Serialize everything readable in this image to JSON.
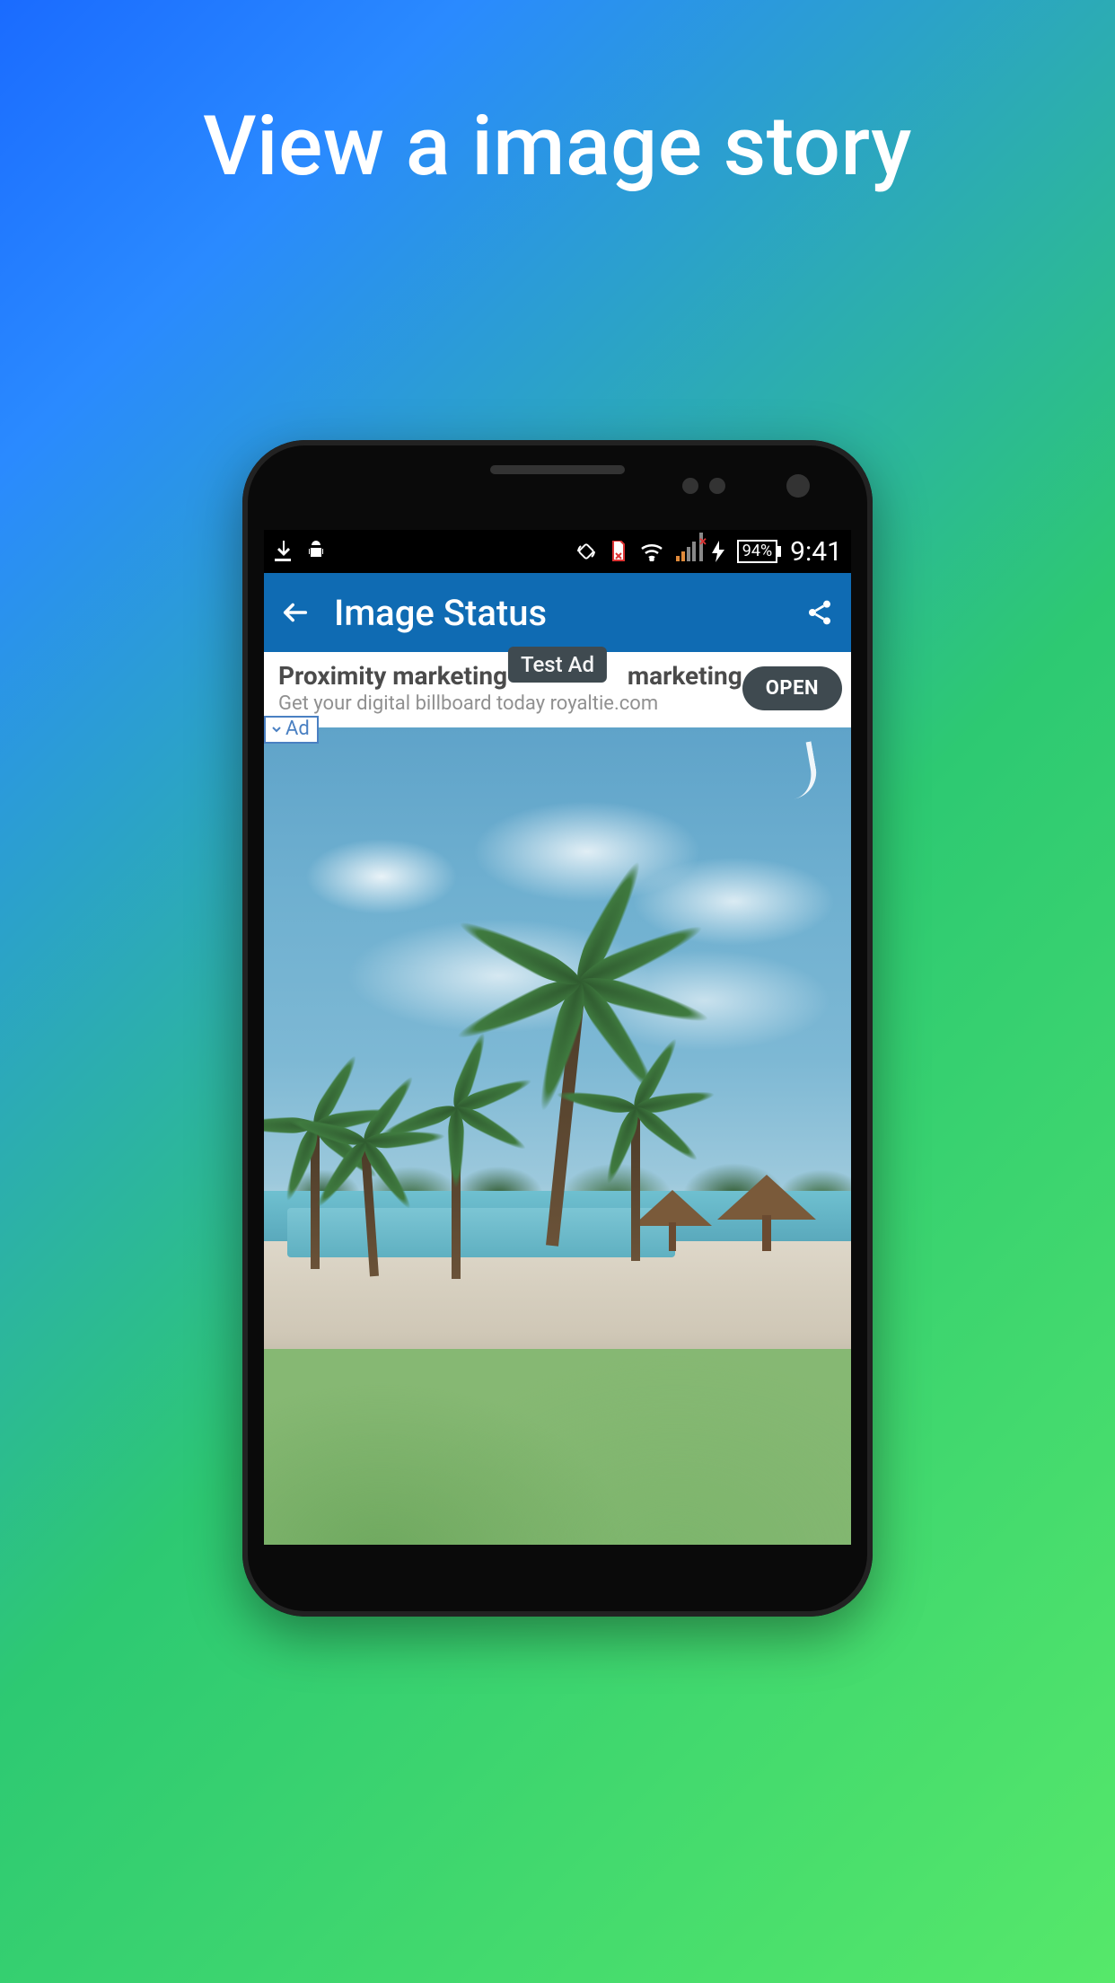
{
  "promo": {
    "title": "View a image story"
  },
  "statusbar": {
    "battery_text": "94%",
    "clock": "9:41"
  },
  "appbar": {
    "title": "Image Status"
  },
  "ad": {
    "title_full": "Proximity marketing - Royaltie marketing",
    "title_left": "Proximity marketing - ",
    "title_right": " marketing",
    "subtitle": "Get your digital billboard today royaltie.com",
    "test_label": "Test Ad",
    "open_label": "OPEN",
    "ad_badge": "Ad"
  }
}
